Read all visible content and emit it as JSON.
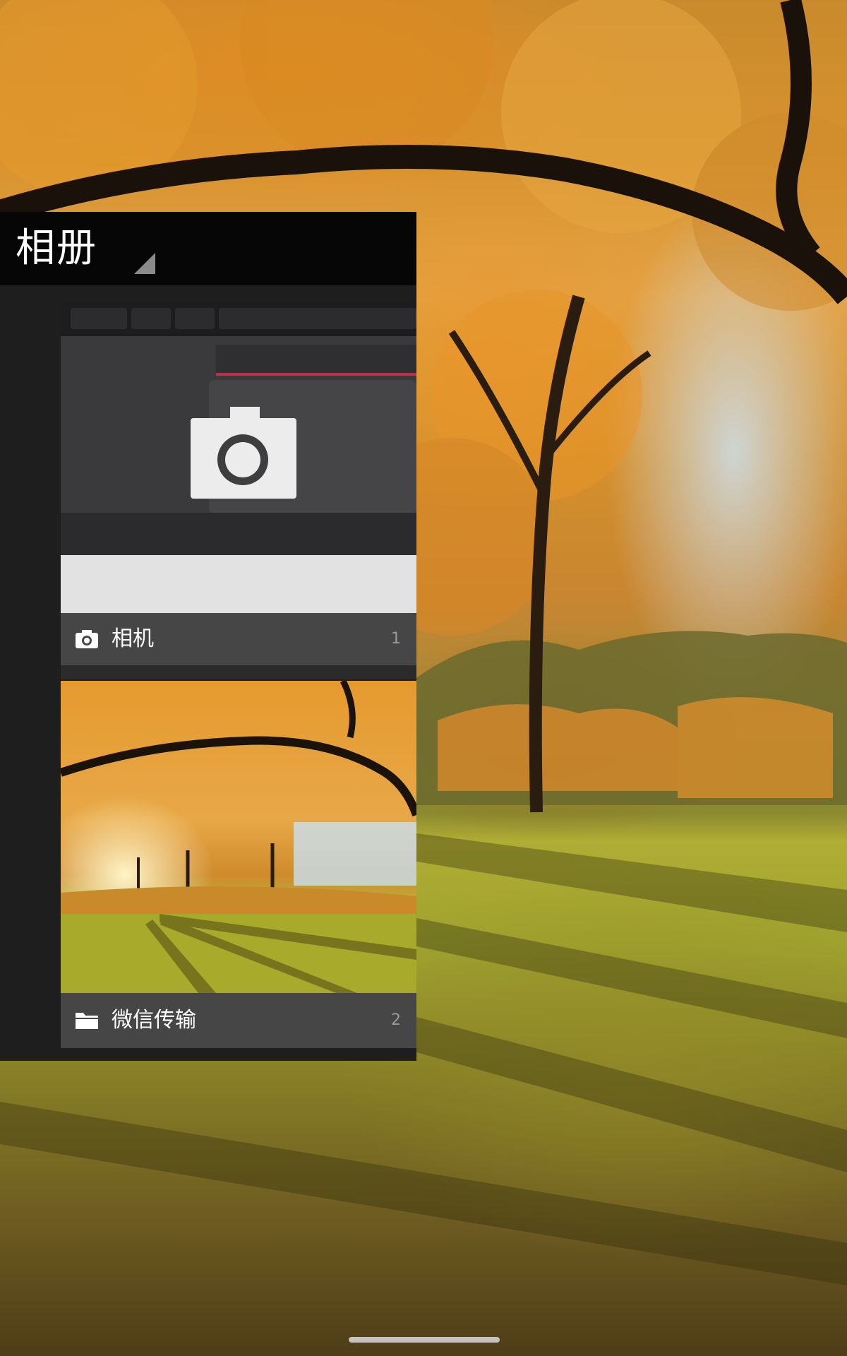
{
  "panel": {
    "title": "相册"
  },
  "albums": [
    {
      "name": "相机",
      "count": "1",
      "icon": "camera-icon"
    },
    {
      "name": "微信传输",
      "count": "2",
      "icon": "folder-icon"
    }
  ],
  "colors": {
    "panel_bg": "#1e1e1e",
    "header_bg": "#060606",
    "bar_bg": "#464646",
    "count_text": "#9a9a9a"
  }
}
